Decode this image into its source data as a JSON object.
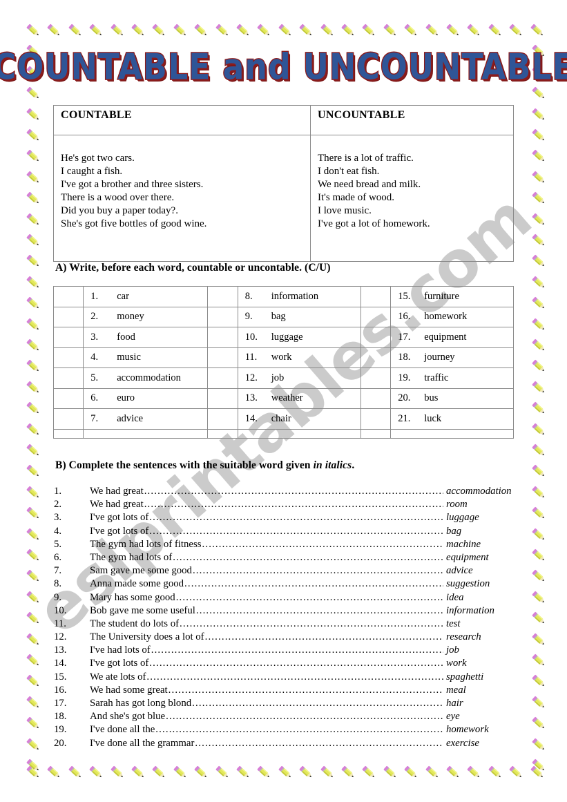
{
  "title": "COUNTABLE and  UNCOUNTABLE",
  "watermark": "eslprintables.com",
  "colors": {
    "title_fill": "#2f5597",
    "title_outline": "#8c1b1b",
    "watermark": "#c9c9c9",
    "table_border": "#8a8a8a",
    "pencil_body": "#e2e85a",
    "pencil_eraser": "#d77fd7",
    "pencil_tip": "#1a1a1a"
  },
  "def_table": {
    "headers": [
      "COUNTABLE",
      "UNCOUNTABLE"
    ],
    "countable": [
      "He's got two cars.",
      "I caught a fish.",
      "I've got a brother and three sisters.",
      "There is a wood over there.",
      "Did you buy a paper today?.",
      "She's got five bottles of good wine."
    ],
    "uncountable": [
      "There is a lot of traffic.",
      "I don't eat fish.",
      "We need bread and milk.",
      "It's made of wood.",
      "I love music.",
      "I've got a lot of homework."
    ]
  },
  "exercise_a": {
    "heading": "A)  Write, before each word, countable or uncontable. (C/U)",
    "columns": [
      [
        {
          "n": "1.",
          "word": "car"
        },
        {
          "n": "2.",
          "word": "money"
        },
        {
          "n": "3.",
          "word": "food"
        },
        {
          "n": "4.",
          "word": "music"
        },
        {
          "n": "5.",
          "word": "accommodation"
        },
        {
          "n": "6.",
          "word": "euro"
        },
        {
          "n": "7.",
          "word": "advice"
        }
      ],
      [
        {
          "n": "8.",
          "word": "information"
        },
        {
          "n": "9.",
          "word": "bag"
        },
        {
          "n": "10.",
          "word": "luggage"
        },
        {
          "n": "11.",
          "word": "work"
        },
        {
          "n": "12.",
          "word": "job"
        },
        {
          "n": "13.",
          "word": "weather"
        },
        {
          "n": "14.",
          "word": "chair"
        }
      ],
      [
        {
          "n": "15.",
          "word": "furniture"
        },
        {
          "n": "16.",
          "word": "homework"
        },
        {
          "n": "17.",
          "word": "equipment"
        },
        {
          "n": "18.",
          "word": "journey"
        },
        {
          "n": "19.",
          "word": "traffic"
        },
        {
          "n": "20.",
          "word": "bus"
        },
        {
          "n": "21.",
          "word": "luck"
        }
      ]
    ]
  },
  "exercise_b": {
    "heading_pre": "B)  Complete the sentences with the suitable word given ",
    "heading_italic": "in italics",
    "heading_post": ".",
    "items": [
      {
        "n": "1.",
        "text": "We had great",
        "answer": "accommodation"
      },
      {
        "n": "2.",
        "text": "We had great",
        "answer": "room"
      },
      {
        "n": "3.",
        "text": "I've got lots of ",
        "answer": "luggage"
      },
      {
        "n": "4.",
        "text": "I've got lots of ",
        "answer": "bag"
      },
      {
        "n": "5.",
        "text": "The gym had lots of fitness",
        "answer": "machine"
      },
      {
        "n": "6.",
        "text": "The gym had lots of ",
        "answer": "equipment"
      },
      {
        "n": "7.",
        "text": "Sam gave me some good ",
        "answer": "advice"
      },
      {
        "n": "8.",
        "text": "Anna made some good",
        "answer": "suggestion"
      },
      {
        "n": "9.",
        "text": "Mary has some good ",
        "answer": "idea"
      },
      {
        "n": "10.",
        "text": "Bob gave me some useful ",
        "answer": "information"
      },
      {
        "n": "11.",
        "text": "The student do lots of ",
        "answer": "test"
      },
      {
        "n": "12.",
        "text": "The University does a lot of ",
        "answer": "research"
      },
      {
        "n": "13.",
        "text": "I've had lots of ",
        "answer": "job"
      },
      {
        "n": "14.",
        "text": "I've got  lots of ",
        "answer": "work"
      },
      {
        "n": "15.",
        "text": "We ate lots of ",
        "answer": "spaghetti"
      },
      {
        "n": "16.",
        "text": "We had some great ",
        "answer": "meal"
      },
      {
        "n": "17.",
        "text": "Sarah has got long blond",
        "answer": "hair"
      },
      {
        "n": "18.",
        "text": "And she's got blue",
        "answer": "eye"
      },
      {
        "n": "19.",
        "text": "I've done all the ",
        "answer": "homework"
      },
      {
        "n": "20.",
        "text": "I've done all the grammar",
        "answer": "exercise"
      }
    ]
  }
}
